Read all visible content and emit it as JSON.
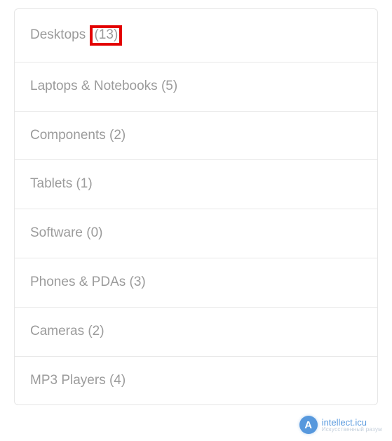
{
  "categories": [
    {
      "label": "Desktops",
      "count_text": "(13)",
      "highlighted_count": true
    },
    {
      "label": "Laptops & Notebooks",
      "count_text": "(5)",
      "highlighted_count": false
    },
    {
      "label": "Components",
      "count_text": "(2)",
      "highlighted_count": false
    },
    {
      "label": "Tablets",
      "count_text": "(1)",
      "highlighted_count": false
    },
    {
      "label": "Software",
      "count_text": "(0)",
      "highlighted_count": false
    },
    {
      "label": "Phones & PDAs",
      "count_text": "(3)",
      "highlighted_count": false
    },
    {
      "label": "Cameras",
      "count_text": "(2)",
      "highlighted_count": false
    },
    {
      "label": "MP3 Players",
      "count_text": "(4)",
      "highlighted_count": false
    }
  ],
  "watermark": {
    "icon_letter": "A",
    "title": "intellect.icu",
    "subtitle": "Искусственный разум"
  }
}
